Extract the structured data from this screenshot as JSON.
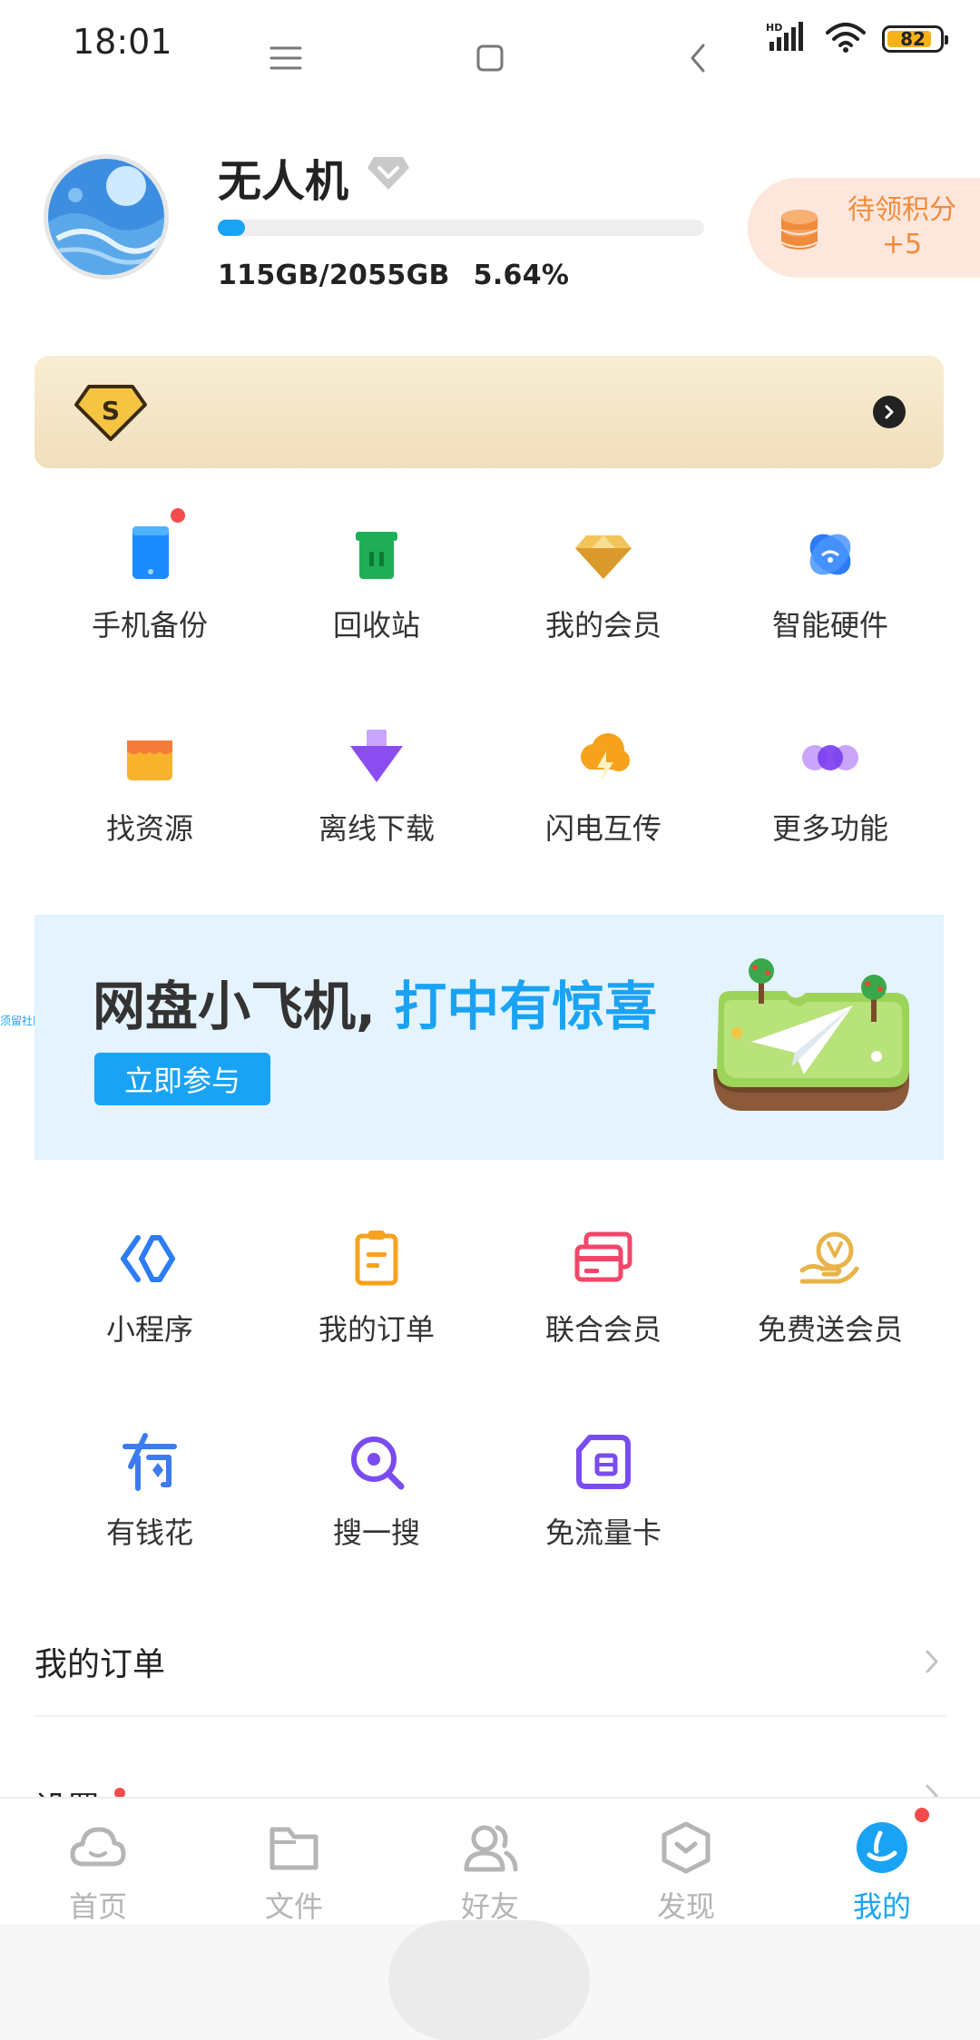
{
  "status_bar": {
    "time": "18:01",
    "network_tag": "HD",
    "battery": "82"
  },
  "profile": {
    "name": "无人机",
    "storage_used": "115GB/2055GB",
    "storage_percent": "5.64%",
    "storage_fraction": 0.0564,
    "points": {
      "label": "待领积分",
      "value": "+5"
    }
  },
  "vip_banner": {
    "badge_letter": "S"
  },
  "grid_top": [
    {
      "label": "手机备份",
      "icon": "phone-backup-icon",
      "color": "#1a8cff",
      "badge": true
    },
    {
      "label": "回收站",
      "icon": "recycle-bin-icon",
      "color": "#1fae55",
      "badge": false
    },
    {
      "label": "我的会员",
      "icon": "diamond-icon",
      "color": "#e8b34a",
      "badge": false
    },
    {
      "label": "智能硬件",
      "icon": "smart-hardware-icon",
      "color": "#2d7cf6",
      "badge": false
    },
    {
      "label": "找资源",
      "icon": "shop-icon",
      "color": "#f7b32b",
      "badge": false
    },
    {
      "label": "离线下载",
      "icon": "offline-download-icon",
      "color": "#8b4cf0",
      "badge": false
    },
    {
      "label": "闪电互传",
      "icon": "lightning-transfer-icon",
      "color": "#f7a21c",
      "badge": false
    },
    {
      "label": "更多功能",
      "icon": "more-dots-icon",
      "color": "#9b5cf6",
      "badge": false
    }
  ],
  "promo": {
    "title_main": "网盘小飞机, ",
    "title_highlight": "打中有惊喜",
    "button": "立即参与",
    "side_tag": "须留社区"
  },
  "grid_bottom": [
    {
      "label": "小程序",
      "icon": "mini-program-icon",
      "color": "#2d7cf6"
    },
    {
      "label": "我的订单",
      "icon": "clipboard-icon",
      "color": "#f7a21c"
    },
    {
      "label": "联合会员",
      "icon": "cards-icon",
      "color": "#f0476a"
    },
    {
      "label": "免费送会员",
      "icon": "gift-vip-icon",
      "color": "#e8b34a"
    },
    {
      "label": "有钱花",
      "icon": "money-icon",
      "color": "#3d7bf0"
    },
    {
      "label": "搜一搜",
      "icon": "search-icon",
      "color": "#7a4cf0"
    },
    {
      "label": "免流量卡",
      "icon": "sim-card-icon",
      "color": "#7a4cf0"
    }
  ],
  "list": [
    {
      "label": "我的订单"
    },
    {
      "label": "设置"
    }
  ],
  "tabs": [
    {
      "label": "首页",
      "icon": "cloud-icon",
      "active": false
    },
    {
      "label": "文件",
      "icon": "folder-icon",
      "active": false
    },
    {
      "label": "好友",
      "icon": "friends-icon",
      "active": false
    },
    {
      "label": "发现",
      "icon": "discover-icon",
      "active": false
    },
    {
      "label": "我的",
      "icon": "profile-icon",
      "active": true
    }
  ],
  "colors": {
    "accent": "#1aa3f4",
    "points_text": "#f08b3c",
    "badge_red": "#f44c4c"
  }
}
